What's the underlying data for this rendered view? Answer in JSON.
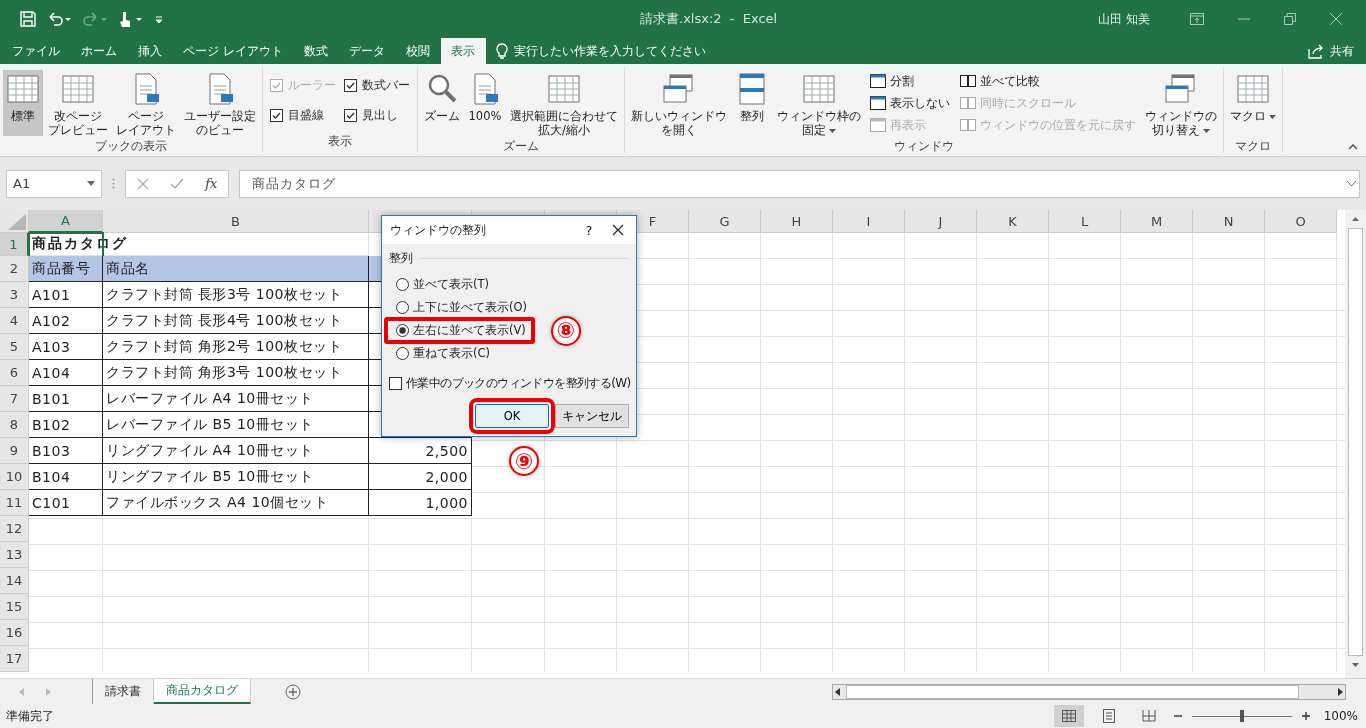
{
  "window": {
    "title": "請求書.xlsx:2  -  Excel",
    "user": "山田 知美"
  },
  "menu_tabs": [
    {
      "label": "ファイル",
      "selected": false
    },
    {
      "label": "ホーム",
      "selected": false
    },
    {
      "label": "挿入",
      "selected": false
    },
    {
      "label": "ページ レイアウト",
      "selected": false
    },
    {
      "label": "数式",
      "selected": false
    },
    {
      "label": "データ",
      "selected": false
    },
    {
      "label": "校閲",
      "selected": false
    },
    {
      "label": "表示",
      "selected": true
    }
  ],
  "tell_me": {
    "placeholder": "実行したい作業を入力してください"
  },
  "share": "共有",
  "ribbon": {
    "groups": [
      {
        "label": "ブックの表示",
        "items": [
          {
            "kind": "large",
            "lines": [
              "標準"
            ],
            "selected": true,
            "disabled": false,
            "dropdown": false
          },
          {
            "kind": "large",
            "lines": [
              "改ページ",
              "プレビュー"
            ],
            "selected": false,
            "disabled": false,
            "dropdown": false
          },
          {
            "kind": "large",
            "lines": [
              "ページ",
              "レイアウト"
            ],
            "selected": false,
            "disabled": false,
            "dropdown": false
          },
          {
            "kind": "large",
            "lines": [
              "ユーザー設定",
              "のビュー"
            ],
            "selected": false,
            "disabled": false,
            "dropdown": false
          }
        ]
      },
      {
        "label": "表示",
        "items": [
          {
            "kind": "check",
            "label": "ルーラー",
            "checked": true,
            "disabled": true
          },
          {
            "kind": "check",
            "label": "数式バー",
            "checked": true,
            "disabled": false
          },
          {
            "kind": "check",
            "label": "目盛線",
            "checked": true,
            "disabled": false
          },
          {
            "kind": "check",
            "label": "見出し",
            "checked": true,
            "disabled": false
          }
        ]
      },
      {
        "label": "ズーム",
        "items": [
          {
            "kind": "large",
            "lines": [
              "ズーム"
            ],
            "selected": false,
            "disabled": false,
            "dropdown": false
          },
          {
            "kind": "large",
            "lines": [
              "100%"
            ],
            "selected": false,
            "disabled": false,
            "dropdown": false
          },
          {
            "kind": "large",
            "lines": [
              "選択範囲に合わせて",
              "拡大/縮小"
            ],
            "selected": false,
            "disabled": false,
            "dropdown": false
          }
        ]
      },
      {
        "label": "ウィンドウ",
        "items": [
          {
            "kind": "large",
            "lines": [
              "新しいウィンドウ",
              "を開く"
            ],
            "selected": false,
            "disabled": false,
            "dropdown": false
          },
          {
            "kind": "large",
            "lines": [
              "整列"
            ],
            "selected": false,
            "disabled": false,
            "dropdown": false
          },
          {
            "kind": "large",
            "lines": [
              "ウィンドウ枠の",
              "固定"
            ],
            "selected": false,
            "disabled": false,
            "dropdown": true
          },
          {
            "kind": "small",
            "label": "分割",
            "disabled": false
          },
          {
            "kind": "small",
            "label": "表示しない",
            "disabled": false
          },
          {
            "kind": "small",
            "label": "再表示",
            "disabled": true
          },
          {
            "kind": "small",
            "label": "並べて比較",
            "disabled": false
          },
          {
            "kind": "small",
            "label": "同時にスクロール",
            "disabled": true
          },
          {
            "kind": "small",
            "label": "ウィンドウの位置を元に戻す",
            "disabled": true
          },
          {
            "kind": "large",
            "lines": [
              "ウィンドウの",
              "切り替え"
            ],
            "selected": false,
            "disabled": false,
            "dropdown": true
          }
        ]
      },
      {
        "label": "マクロ",
        "items": [
          {
            "kind": "large",
            "lines": [
              "マクロ"
            ],
            "selected": false,
            "disabled": false,
            "dropdown": true
          }
        ]
      }
    ]
  },
  "formula_bar": {
    "name_box": "A1",
    "function_symbol": "fx",
    "value": "商品カタログ"
  },
  "sheet": {
    "columns": [
      {
        "label": "A",
        "selected": true
      },
      {
        "label": "B",
        "selected": false
      },
      {
        "selected": false
      },
      {
        "selected": false
      },
      {
        "selected": false
      },
      {
        "label": "F",
        "selected": false
      },
      {
        "label": "G",
        "selected": false
      },
      {
        "label": "H",
        "selected": false
      },
      {
        "label": "I",
        "selected": false
      },
      {
        "label": "J",
        "selected": false
      },
      {
        "label": "K",
        "selected": false
      },
      {
        "label": "L",
        "selected": false
      },
      {
        "label": "M",
        "selected": false
      },
      {
        "label": "N",
        "selected": false
      },
      {
        "label": "O",
        "selected": false
      }
    ],
    "rows": [
      {
        "number": "1",
        "selected": true,
        "kind": "title",
        "cells": [
          "商品カタログ"
        ]
      },
      {
        "number": "2",
        "selected": false,
        "kind": "header",
        "cells": [
          "商品番号",
          "商品名"
        ]
      },
      {
        "number": "3",
        "selected": false,
        "kind": "data",
        "cells": [
          "A101",
          "クラフト封筒 長形3号 100枚セット"
        ]
      },
      {
        "number": "4",
        "selected": false,
        "kind": "data",
        "cells": [
          "A102",
          "クラフト封筒 長形4号 100枚セット"
        ]
      },
      {
        "number": "5",
        "selected": false,
        "kind": "data",
        "cells": [
          "A103",
          "クラフト封筒 角形2号 100枚セット"
        ]
      },
      {
        "number": "6",
        "selected": false,
        "kind": "data",
        "cells": [
          "A104",
          "クラフト封筒 角形3号 100枚セット"
        ]
      },
      {
        "number": "7",
        "selected": false,
        "kind": "data",
        "cells": [
          "B101",
          "レバーファイル A4 10冊セット"
        ]
      },
      {
        "number": "8",
        "selected": false,
        "kind": "data",
        "cells": [
          "B102",
          "レバーファイル B5 10冊セット"
        ]
      },
      {
        "number": "9",
        "selected": false,
        "kind": "data",
        "cells": [
          "B103",
          "リングファイル A4 10冊セット",
          "2,500"
        ]
      },
      {
        "number": "10",
        "selected": false,
        "kind": "data",
        "cells": [
          "B104",
          "リングファイル B5 10冊セット",
          "2,000"
        ]
      },
      {
        "number": "11",
        "selected": false,
        "kind": "data",
        "cells": [
          "C101",
          "ファイルボックス A4 10個セット",
          "1,000"
        ]
      },
      {
        "number": "12",
        "selected": false,
        "kind": "empty"
      },
      {
        "number": "13",
        "selected": false,
        "kind": "empty"
      },
      {
        "number": "14",
        "selected": false,
        "kind": "empty"
      },
      {
        "number": "15",
        "selected": false,
        "kind": "empty"
      },
      {
        "number": "16",
        "selected": false,
        "kind": "empty"
      },
      {
        "number": "17",
        "selected": false,
        "kind": "empty"
      }
    ]
  },
  "dialog": {
    "title": "ウィンドウの整列",
    "help": "?",
    "group_label": "整列",
    "options": [
      {
        "label": "並べて表示(T)",
        "selected": false,
        "highlighted": false
      },
      {
        "label": "上下に並べて表示(O)",
        "selected": false,
        "highlighted": false
      },
      {
        "label": "左右に並べて表示(V)",
        "selected": true,
        "highlighted": true,
        "callout": "⑧"
      },
      {
        "label": "重ねて表示(C)",
        "selected": false,
        "highlighted": false
      }
    ],
    "checkbox": {
      "label": "作業中のブックのウィンドウを整列する(W)",
      "checked": false
    },
    "buttons": [
      {
        "label": "OK",
        "default": true,
        "highlighted": true,
        "callout": "⑨"
      },
      {
        "label": "キャンセル",
        "default": false,
        "highlighted": false
      }
    ]
  },
  "sheet_tabs": [
    {
      "label": "請求書",
      "selected": false
    },
    {
      "label": "商品カタログ",
      "selected": true
    }
  ],
  "status_bar": {
    "text": "準備完了",
    "zoom": {
      "level": 0.5,
      "reading": "100%"
    }
  }
}
